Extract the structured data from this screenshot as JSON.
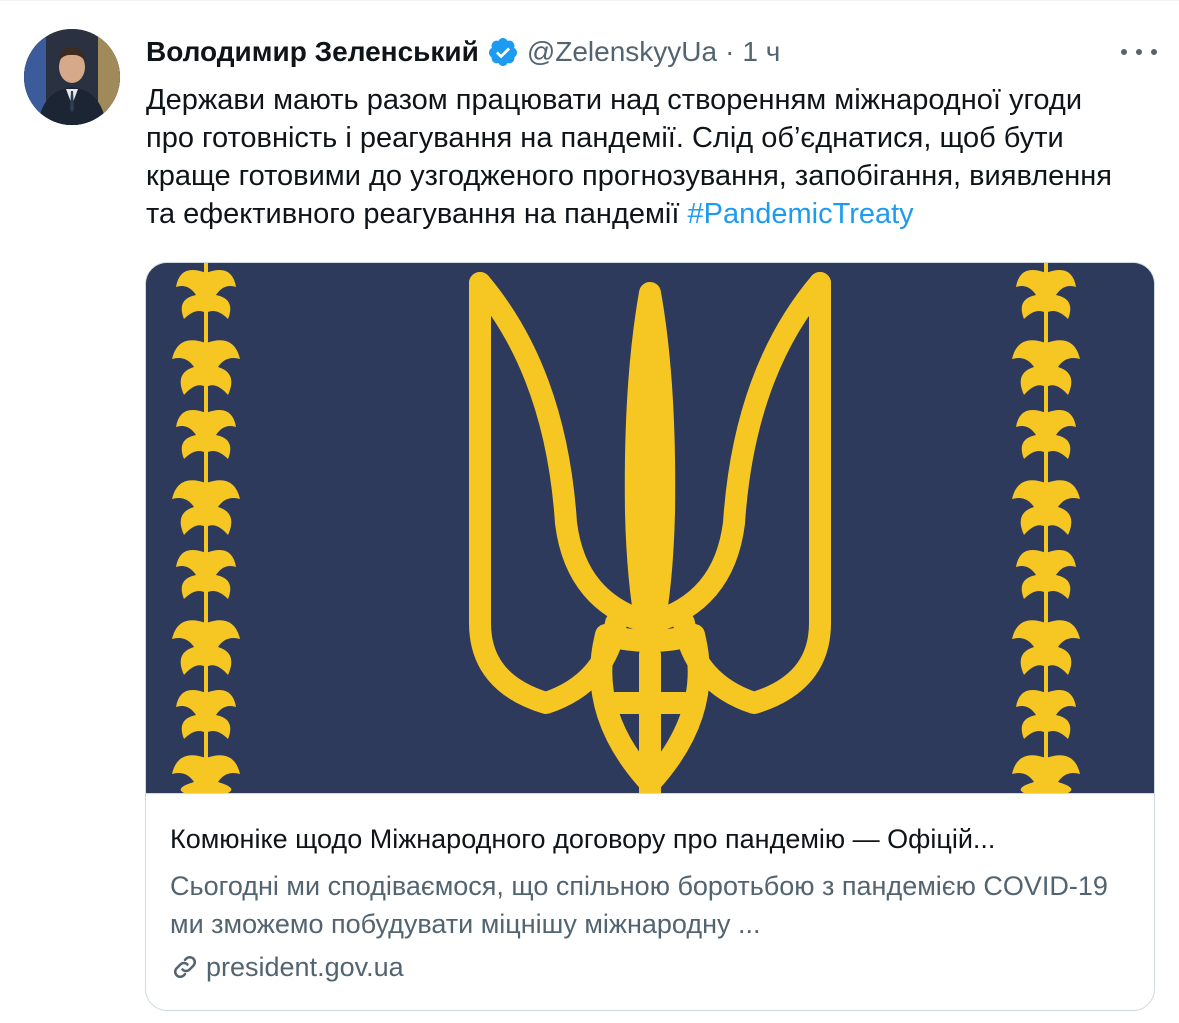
{
  "tweet": {
    "author_name": "Володимир Зеленський",
    "handle": "@ZelenskyyUa",
    "separator": "·",
    "time": "1 ч",
    "text": "Держави мають разом працювати над створенням міжнародної угоди про готовність і реагування на пандемії. Слід об’єднатися, щоб бути краще готовими до узгодженого прогнозування, запобігання, виявлення та ефективного реагування на пандемії ",
    "hashtag": "#PandemicTreaty"
  },
  "card": {
    "title": "Комюніке щодо Міжнародного договору про пандемію — Офіцій...",
    "description": "Сьогодні ми сподіваємося, що спільною боротьбою з пандемією COVID-19 ми зможемо побудувати міцнішу міжнародну ...",
    "domain": "president.gov.ua"
  },
  "icons": {
    "verified": "verified-badge-icon",
    "more": "more-icon",
    "link": "link-icon",
    "card_image": "trident-emblem"
  },
  "colors": {
    "accent": "#1d9bf0",
    "secondary_text": "#536471",
    "card_background": "#2d3a5c",
    "emblem": "#f6c623"
  }
}
